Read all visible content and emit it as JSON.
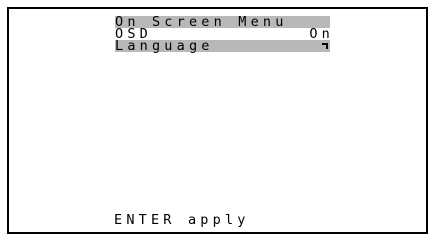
{
  "menu": {
    "title": "On Screen Menu",
    "items": [
      {
        "label": "OSD",
        "value": "On"
      },
      {
        "label": "Language",
        "icon": "enter-icon",
        "highlighted": true
      }
    ]
  },
  "footer": {
    "hint": "ENTER apply"
  },
  "colors": {
    "highlight": "#b8b8b8",
    "text": "#000000",
    "background": "#ffffff"
  }
}
